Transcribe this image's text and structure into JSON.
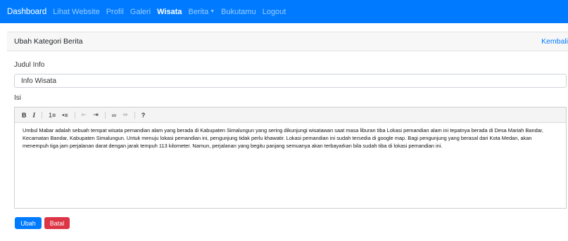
{
  "navbar": {
    "brand": "Dashboard",
    "items": [
      "Lihat Website",
      "Profil",
      "Galeri",
      "Wisata",
      "Berita",
      "Bukutamu",
      "Logout"
    ],
    "active_item": "Wisata",
    "accent": "#007bff"
  },
  "card": {
    "title": "Ubah Kategori Berita",
    "back_label": "Kembali"
  },
  "form": {
    "judul_label": "Judul Info",
    "judul_value": "Info Wisata",
    "isi_label": "Isi",
    "toolbar": [
      "B",
      "I",
      "1≡",
      "•≡",
      "⇤",
      "⇥",
      "∞",
      "⇹",
      "?"
    ],
    "isi_value": "Umbul Mabar adalah sebuah tempat wisata pemandian alam yang berada di Kabupaten Simalungun yang sering dikunjungi wisatawan saat masa liburan tiba Lokasi pemandian alam ini tepatnya berada di Desa Mariah Bandar, Kecamatan Bandar, Kabupaten Simalungun. Untuk menuju lokasi pemandian ini, pengunjung tidak perlu khawatir. Lokasi pemandian ini sudah tersedia di google map. Bagi pengunjung yang berasal dari Kota Medan, akan menempuh tiga jam perjalanan darat dengan jarak tempuh 113 kilometer. Namun, perjalanan yang begitu panjang semuanya akan terbayarkan bila sudah tiba di lokasi pemandian ini."
  },
  "buttons": {
    "submit_label": "Ubah",
    "cancel_label": "Batal",
    "danger_color": "#dc3545"
  }
}
